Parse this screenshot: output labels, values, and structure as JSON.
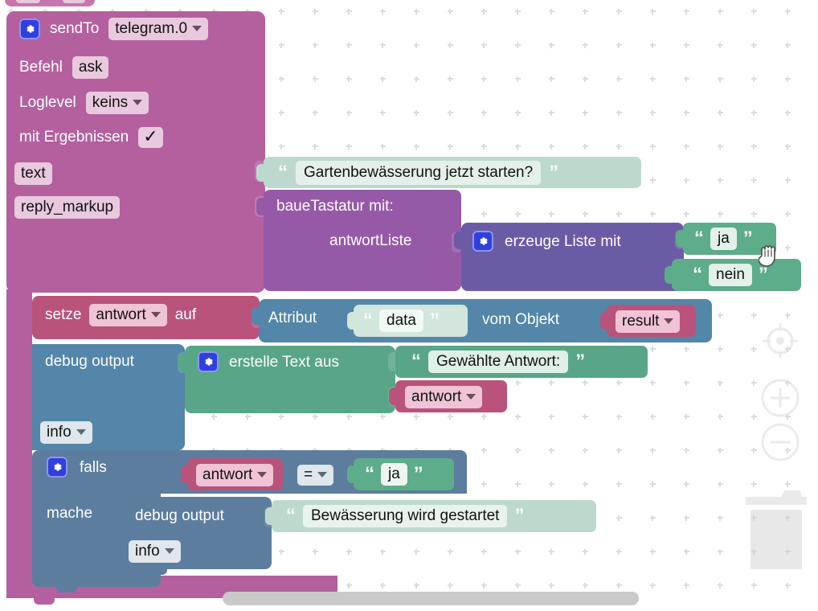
{
  "app": {
    "type": "blockly-visual-programming-workspace",
    "language": "de"
  },
  "blocks": {
    "sendto": {
      "icon": "gear-icon",
      "label": "sendTo",
      "instance_value": "telegram.0",
      "rows": [
        {
          "label": "Befehl",
          "value": "ask",
          "kind": "text"
        },
        {
          "label": "Loglevel",
          "value": "keins",
          "kind": "dropdown"
        },
        {
          "label": "mit Ergebnissen",
          "value": "✓",
          "kind": "checkbox"
        },
        {
          "label": "text",
          "kind": "socket"
        },
        {
          "label": "reply_markup",
          "kind": "socket"
        }
      ]
    },
    "text_question": {
      "value": "Gartenbewässerung jetzt starten?"
    },
    "keyboard": {
      "label": "baueTastatur  mit:",
      "arg_label": "antwortListe"
    },
    "create_list": {
      "icon": "gear-icon",
      "label": "erzeuge Liste mit",
      "items": [
        "ja",
        "nein"
      ]
    },
    "set_var": {
      "prefix": "setze",
      "variable": "antwort",
      "suffix": "auf"
    },
    "attribute": {
      "label": "Attribut",
      "attr": "data",
      "mid_label": "vom Objekt",
      "object": "result"
    },
    "debug_1": {
      "label": "debug output",
      "level": "info"
    },
    "create_text": {
      "icon": "gear-icon",
      "label": "erstelle Text aus",
      "part1": "Gewählte Antwort:",
      "part2": "antwort"
    },
    "if_block": {
      "icon": "gear-icon",
      "label": "falls",
      "do_label": "mache",
      "condition": {
        "left": "antwort",
        "operator": "=",
        "right": "ja"
      }
    },
    "debug_2": {
      "label": "debug output",
      "level": "info",
      "message": "Bewässerung wird gestartet"
    }
  },
  "controls": {
    "center_label": "center-on-blocks",
    "zoom_in_label": "zoom-in",
    "zoom_out_label": "zoom-out",
    "trash_label": "trash"
  },
  "colors": {
    "sendto": "#B4609F",
    "keyboard": "#9659A8",
    "create_list": "#6B5BA5",
    "set_var": "#B9537C",
    "attribute": "#5386A8",
    "debug": "#5386A8",
    "create_text": "#58A687",
    "string_light": "#BDD9CD",
    "string_green": "#5DAC8A",
    "if_block": "#5C7D9E",
    "grid_dot": "#dcdcdc",
    "scrollbar": "#c9c9c9"
  }
}
